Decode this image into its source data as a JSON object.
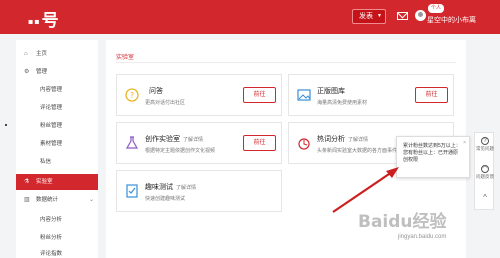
{
  "header": {
    "logo_text": "号",
    "logo_mark": "▪ ▪",
    "publish_label": "发表",
    "user_badge": "个人",
    "username": "星空中的小布离"
  },
  "sidebar": {
    "items": [
      {
        "label": "主页",
        "icon": "home-icon"
      },
      {
        "label": "管理",
        "icon": "gear-icon"
      },
      {
        "label": "内容管理"
      },
      {
        "label": "评论管理"
      },
      {
        "label": "粉丝管理"
      },
      {
        "label": "素材管理"
      },
      {
        "label": "私信"
      },
      {
        "label": "实验室",
        "icon": "flask-icon"
      },
      {
        "label": "数据统计",
        "icon": "chart-icon"
      },
      {
        "label": "内容分析"
      },
      {
        "label": "粉丝分析"
      },
      {
        "label": "评论指数"
      }
    ]
  },
  "main": {
    "section_title": "实验室",
    "cards": [
      {
        "title": "问答",
        "desc": "更高对话付出社区",
        "button": "前往",
        "icon": "question-icon"
      },
      {
        "title": "正版图库",
        "desc": "海量高清免费使用素材",
        "button": "前往",
        "icon": "image-icon"
      },
      {
        "title": "创作实验室",
        "more": "了解详情",
        "desc": "根据特定主题依据创作文化视频",
        "button": "前往",
        "icon": "flask-icon"
      },
      {
        "title": "热词分析",
        "more": "了解详情",
        "desc": "头条新闻实验室大数据的各方面事件",
        "button": "前往",
        "icon": "hot-word-icon"
      },
      {
        "title": "趣味测试",
        "more": "了解详情",
        "desc": "快速创建趣味测试",
        "button": "",
        "icon": "quiz-icon"
      }
    ]
  },
  "tooltip": {
    "line1": "累计粉丝数达到5万以上：",
    "line2": "您有粉丝以上：已开通原",
    "line3": "创权限",
    "close": "×"
  },
  "floatbar": {
    "items": [
      {
        "label": "常见问题",
        "icon": "help-icon",
        "glyph": "?"
      },
      {
        "label": "问题反馈",
        "icon": "feedback-icon",
        "glyph": "◠"
      },
      {
        "label": "",
        "icon": "chevron-up-icon",
        "glyph": "^"
      }
    ]
  },
  "watermark": {
    "text": "Baidu经验",
    "url": "jingyan.baidu.com"
  },
  "colors": {
    "brand_red": "#d2282d",
    "annotation_arrow": "#cc1f1f"
  }
}
